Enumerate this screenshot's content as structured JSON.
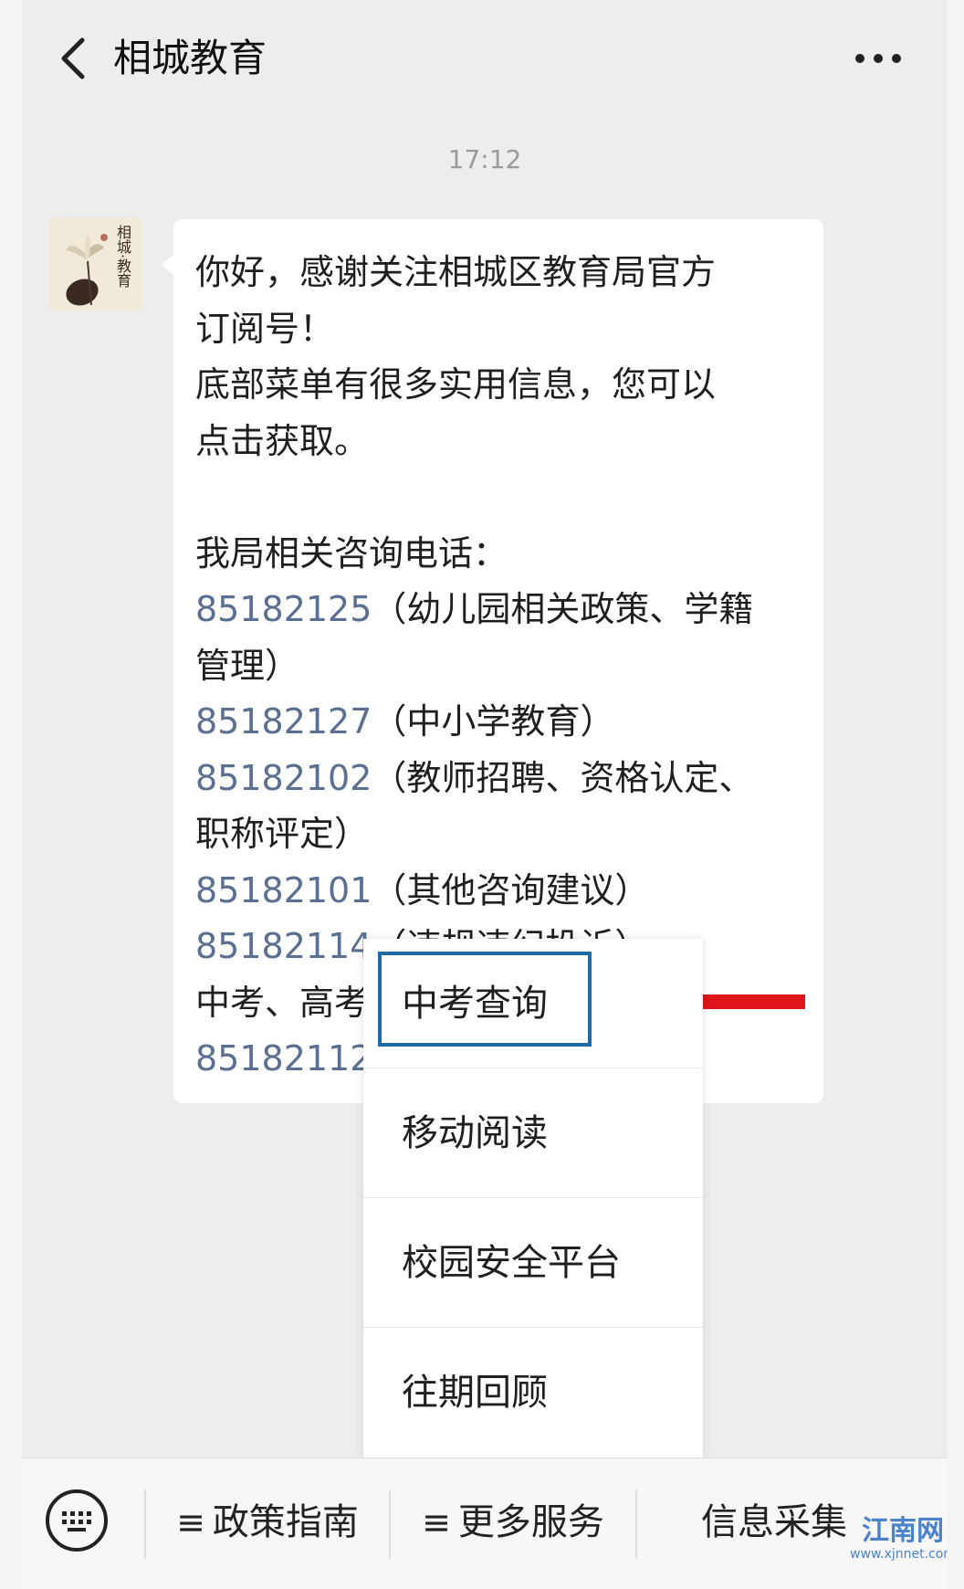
{
  "header": {
    "title": "相城教育"
  },
  "chat": {
    "timestamp": "17:12",
    "avatar_text": "相城·教育",
    "message_lines": [
      {
        "num": "",
        "text": "你好，感谢关注相城区教育局官方"
      },
      {
        "num": "",
        "text": "订阅号！"
      },
      {
        "num": "",
        "text": "底部菜单有很多实用信息，您可以"
      },
      {
        "num": "",
        "text": "点击获取。"
      },
      {
        "num": "",
        "text": ""
      },
      {
        "num": "",
        "text": "我局相关咨询电话："
      },
      {
        "num": "85182125",
        "text": "（幼儿园相关政策、学籍"
      },
      {
        "num": "",
        "text": "管理）"
      },
      {
        "num": "85182127",
        "text": "（中小学教育）"
      },
      {
        "num": "85182102",
        "text": "（教师招聘、资格认定、"
      },
      {
        "num": "",
        "text": "职称评定）"
      },
      {
        "num": "85182101",
        "text": "（其他咨询建议）"
      },
      {
        "num": "85182114",
        "text": "（违规违纪投诉）"
      },
      {
        "num": "",
        "text": "中考、高考"
      },
      {
        "num": "85182112",
        "text": ""
      }
    ]
  },
  "menu": {
    "items": [
      {
        "label": "中考查询",
        "highlighted": true
      },
      {
        "label": "移动阅读"
      },
      {
        "label": "校园安全平台"
      },
      {
        "label": "往期回顾"
      }
    ]
  },
  "bottom_bar": {
    "tabs": [
      {
        "icon": "≡",
        "label": "政策指南"
      },
      {
        "icon": "≡",
        "label": "更多服务"
      },
      {
        "icon": "",
        "label": "信息采集"
      }
    ]
  },
  "watermark": {
    "main": "江南网",
    "sub": "www.xjnnet.com"
  },
  "colors": {
    "link_blue": "#5a6f92",
    "highlight_border": "#1f6aa5",
    "arrow_red": "#e0141b"
  }
}
